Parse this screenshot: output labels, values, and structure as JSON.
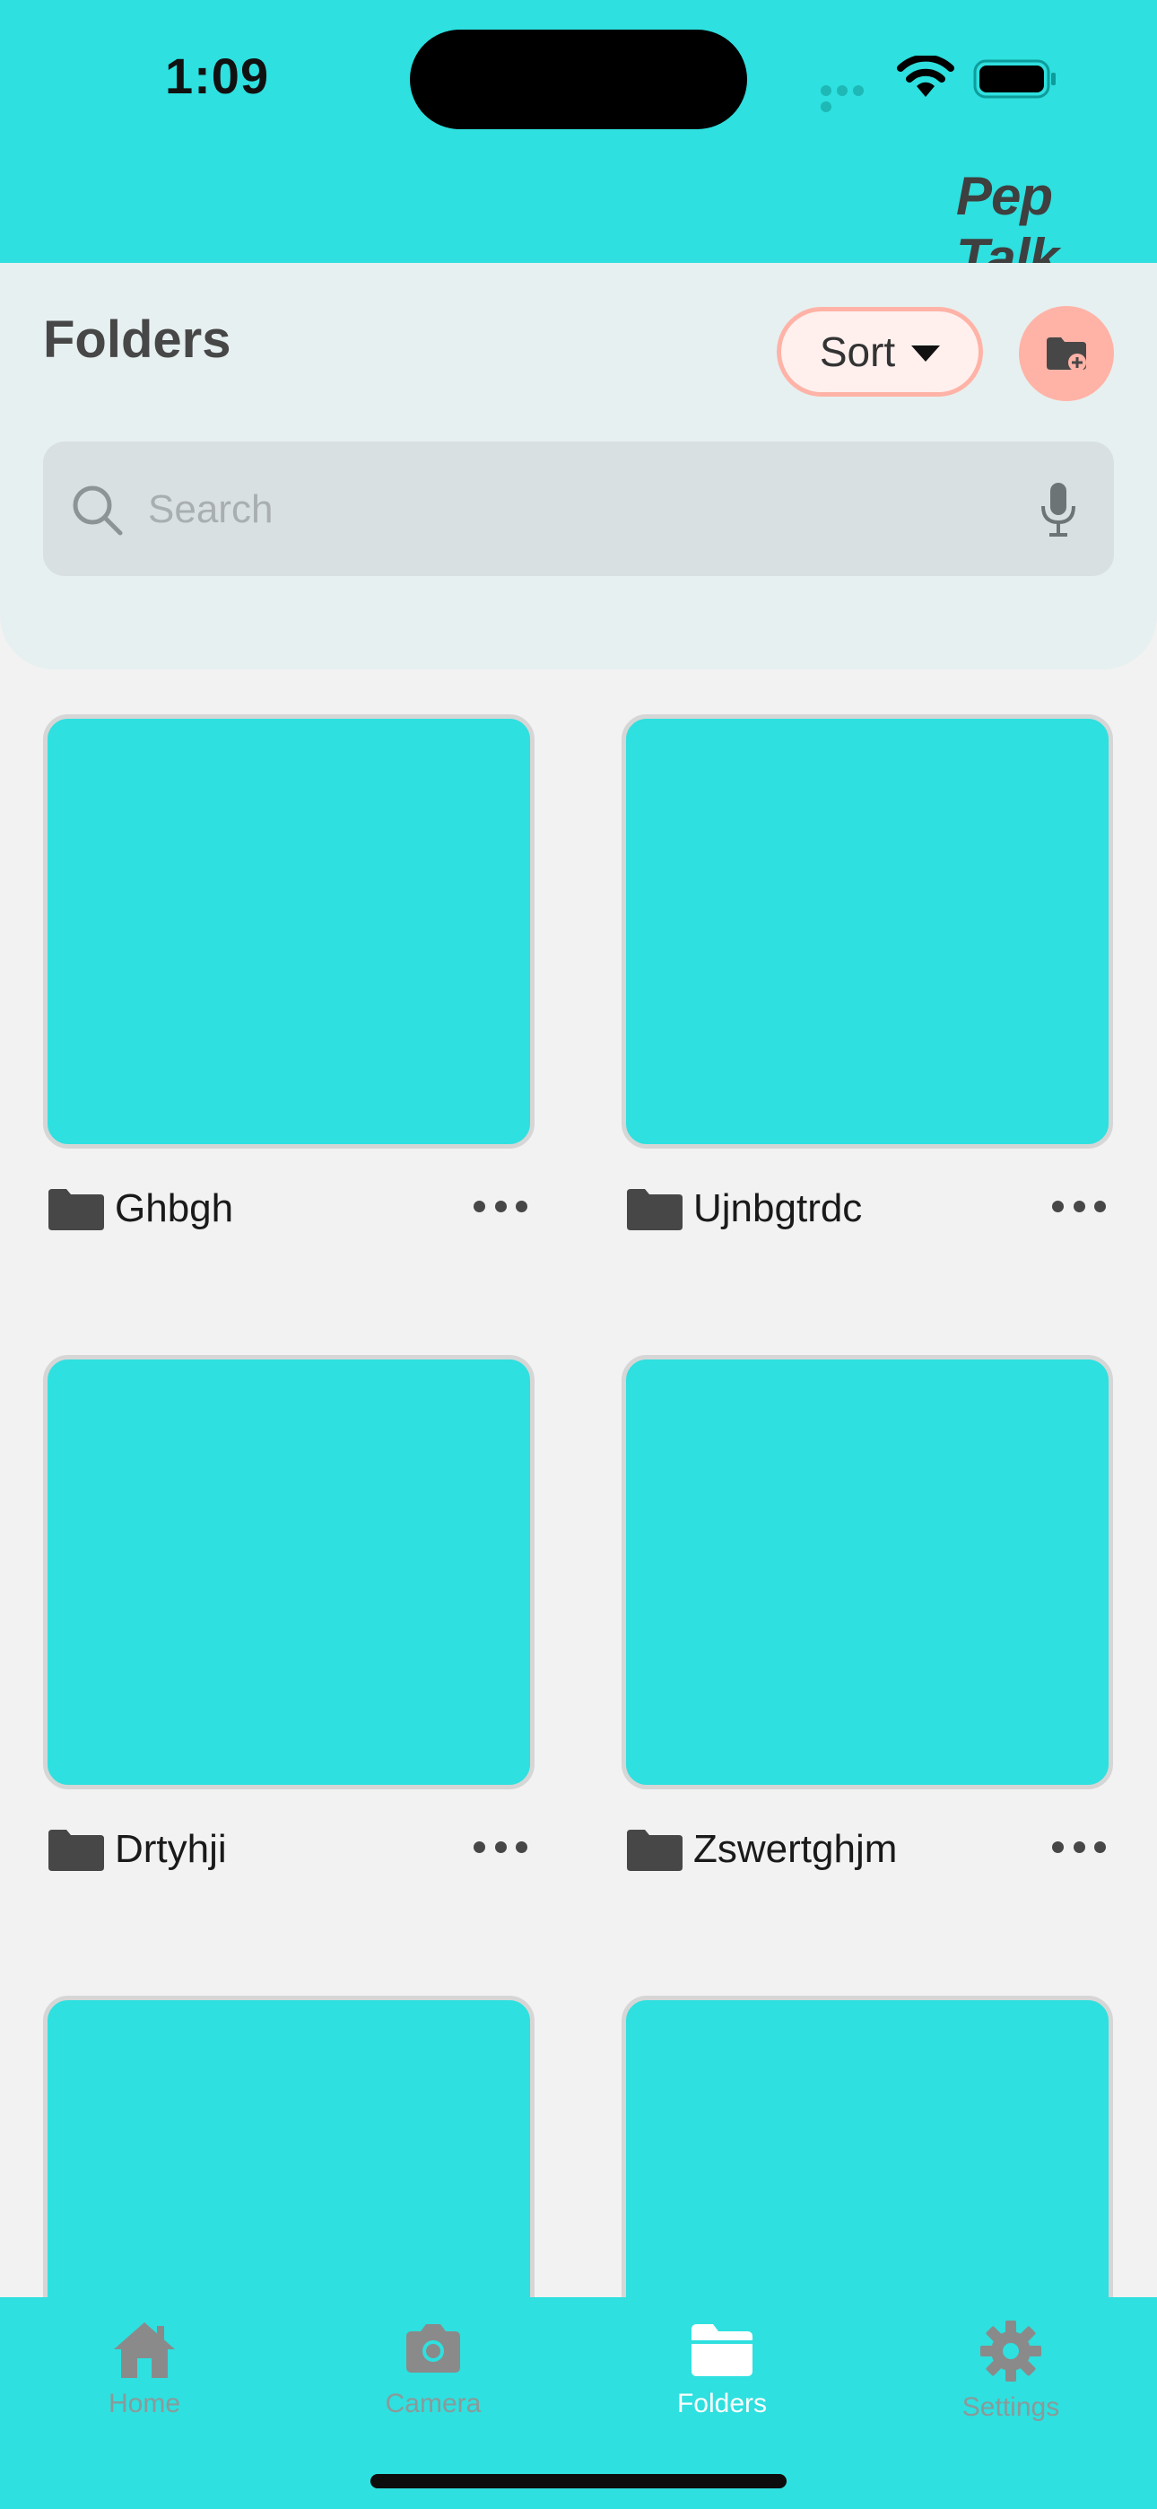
{
  "status_bar": {
    "time": "1:09"
  },
  "header": {
    "brand": "Pep Talk"
  },
  "folders_panel": {
    "title": "Folders",
    "sort_label": "Sort",
    "search_placeholder": "Search"
  },
  "folders": [
    {
      "name": "Ghbgh",
      "icon": "folder-icon"
    },
    {
      "name": "Ujnbgtrdc",
      "icon": "folder-icon"
    },
    {
      "name": "Drtyhji",
      "icon": "folder-icon"
    },
    {
      "name": "Zswertghjm",
      "icon": "folder-icon"
    },
    {
      "name": "",
      "icon": "folder-icon"
    },
    {
      "name": "",
      "icon": "folder-icon"
    }
  ],
  "tab_bar": {
    "items": [
      {
        "label": "Home",
        "icon": "home-icon",
        "active": false
      },
      {
        "label": "Camera",
        "icon": "camera-icon",
        "active": false
      },
      {
        "label": "Folders",
        "icon": "folder-icon",
        "active": true
      },
      {
        "label": "Settings",
        "icon": "gear-icon",
        "active": false
      }
    ]
  },
  "colors": {
    "accent": "#2ee0df",
    "panel": "#e7f0f0",
    "sort_border": "#ffb3a7",
    "add_button": "#ffb3a7",
    "text_dark": "#474747"
  }
}
